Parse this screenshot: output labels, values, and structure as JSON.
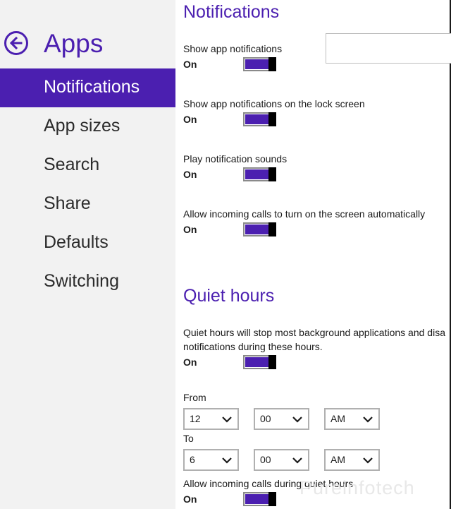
{
  "nav": {
    "title": "Apps",
    "items": [
      {
        "label": "Notifications",
        "selected": true
      },
      {
        "label": "App sizes",
        "selected": false
      },
      {
        "label": "Search",
        "selected": false
      },
      {
        "label": "Share",
        "selected": false
      },
      {
        "label": "Defaults",
        "selected": false
      },
      {
        "label": "Switching",
        "selected": false
      }
    ]
  },
  "notifications": {
    "title": "Notifications",
    "settings": [
      {
        "label": "Show app notifications",
        "state": "On"
      },
      {
        "label": "Show app notifications on the lock screen",
        "state": "On"
      },
      {
        "label": "Play notification sounds",
        "state": "On"
      },
      {
        "label": "Allow incoming calls to turn on the screen automatically",
        "state": "On"
      }
    ]
  },
  "quiet_hours": {
    "title": "Quiet hours",
    "description": "Quiet hours will stop most background applications and disa notifications during these hours.",
    "state": "On",
    "from_label": "From",
    "to_label": "To",
    "from": {
      "hour": "12",
      "minute": "00",
      "period": "AM"
    },
    "to": {
      "hour": "6",
      "minute": "00",
      "period": "AM"
    },
    "calls_label": "Allow incoming calls during quiet hours",
    "calls_state": "On"
  },
  "watermark": "Pureinfotech",
  "colors": {
    "accent": "#4b1fb0",
    "nav_bg": "#f2f2f2",
    "thumb": "#000000"
  }
}
